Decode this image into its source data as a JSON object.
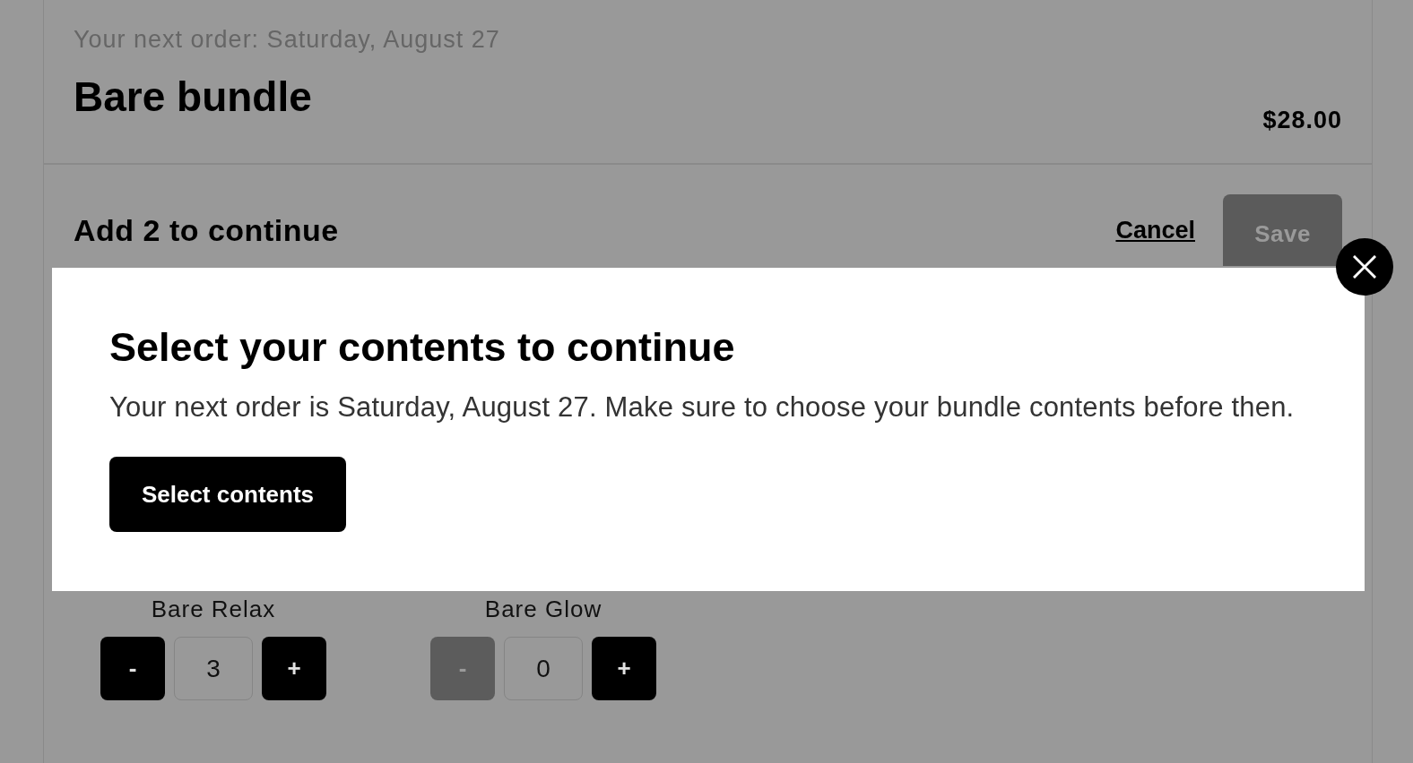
{
  "header": {
    "next_order": "Your next order: Saturday, August 27",
    "title": "Bare bundle",
    "price": "$28.00"
  },
  "selection_bar": {
    "prompt": "Add 2 to continue",
    "cancel": "Cancel",
    "save": {
      "label": "Save",
      "disabled": true
    }
  },
  "products": [
    {
      "name": "Bare Relax",
      "quantity": "3",
      "minus": {
        "label": "-",
        "disabled": false
      },
      "plus": {
        "label": "+",
        "disabled": false
      }
    },
    {
      "name": "Bare Glow",
      "quantity": "0",
      "minus": {
        "label": "-",
        "disabled": true
      },
      "plus": {
        "label": "+",
        "disabled": false
      }
    }
  ],
  "modal": {
    "title": "Select your contents to continue",
    "message": "Your next order is Saturday, August 27. Make sure to choose your bundle contents before then.",
    "button": "Select contents"
  }
}
